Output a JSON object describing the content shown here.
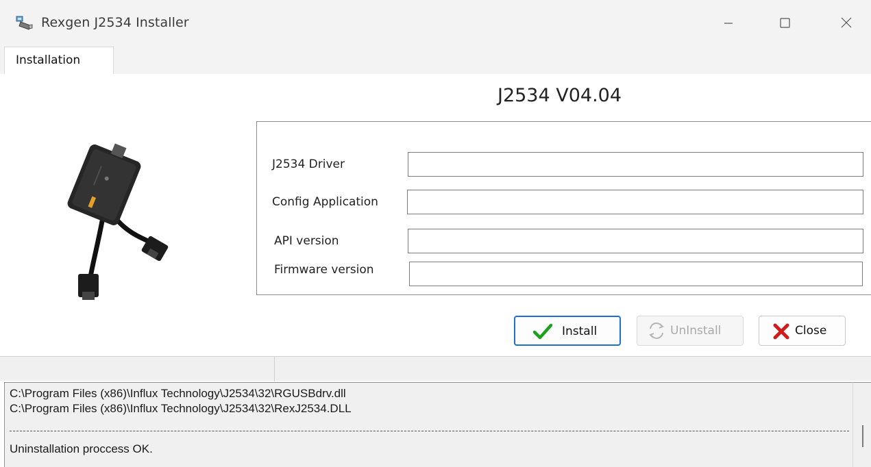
{
  "window": {
    "title": "Rexgen J2534 Installer",
    "app_icon": "usb-device-icon",
    "controls": [
      "minimize-icon",
      "maximize-icon",
      "close-icon"
    ]
  },
  "tabs": [
    {
      "label": "Installation",
      "active": true
    }
  ],
  "main": {
    "version": "J2534 V04.04",
    "device_image": "interface-cable-image",
    "fields": [
      {
        "label": "J2534 Driver",
        "value": ""
      },
      {
        "label": "Config Application",
        "value": ""
      },
      {
        "label": "API version",
        "value": ""
      },
      {
        "label": "Firmware version",
        "value": ""
      }
    ]
  },
  "buttons": {
    "install": {
      "label": "Install",
      "icon": "checkmark-icon",
      "enabled": true
    },
    "uninstall": {
      "label": "UnInstall",
      "icon": "refresh-icon",
      "enabled": false
    },
    "close": {
      "label": "Close",
      "icon": "red-x-icon",
      "enabled": true
    }
  },
  "log": {
    "lines": [
      "C:\\Program Files (x86)\\Influx Technology\\J2534\\32\\RGUSBdrv.dll",
      "C:\\Program Files (x86)\\Influx Technology\\J2534\\32\\RexJ2534.DLL",
      "Uninstallation proccess OK."
    ]
  },
  "colors": {
    "titlebar_bg": "#f3f3f3",
    "focus_border": "#1f6fd0",
    "check_green": "#1aa31a",
    "close_red": "#d01c1c",
    "disabled_text": "#a9a9a9"
  }
}
